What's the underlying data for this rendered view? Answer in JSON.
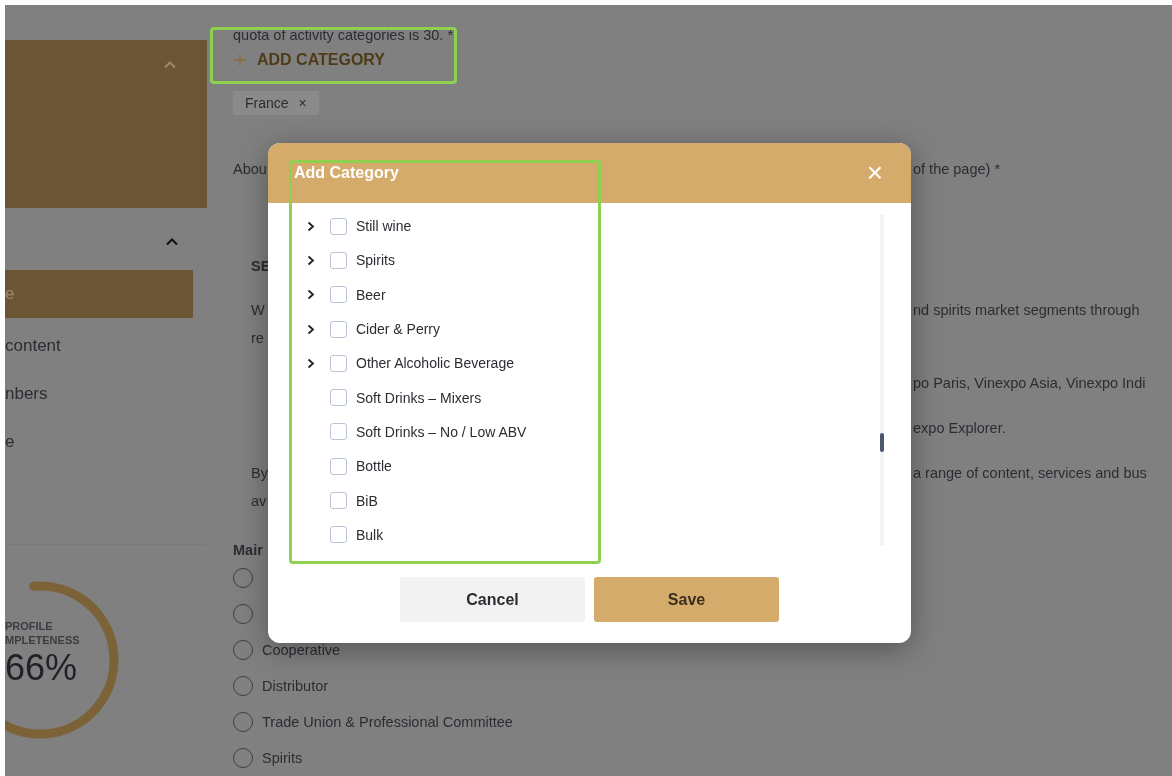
{
  "sidebar": {
    "groups": [
      {
        "expanded": true
      },
      {
        "expanded": true,
        "items": [
          {
            "label": "e",
            "selected": true
          },
          {
            "label": "content",
            "selected": false
          },
          {
            "label": "nbers",
            "selected": false
          },
          {
            "label": "e",
            "selected": false
          }
        ]
      }
    ],
    "profile": {
      "title_lines": [
        "PROFILE",
        "MPLETENESS"
      ],
      "value": "66%",
      "level": 0.66
    }
  },
  "main": {
    "intro": "quota of activity categories is 30. *",
    "add_button": "ADD CATEGORY",
    "chips": [
      {
        "label": "France",
        "close": "×"
      }
    ],
    "about": {
      "left": "Abou",
      "right": "of the page) *"
    },
    "section": {
      "heading": "SE",
      "paragraphs": [
        [
          {
            "left": "W",
            "right": "nd spirits market segments through"
          },
          {
            "left": "re"
          }
        ],
        [
          {
            "right": "po Paris, Vinexpo Asia, Vinexpo Indi"
          }
        ],
        [
          {
            "right": "expo Explorer."
          }
        ],
        [
          {
            "left": "By",
            "right": "a range of content, services and bus"
          },
          {
            "left": "av"
          }
        ]
      ]
    },
    "main_activity": {
      "label": "Mair",
      "options": [
        {
          "selected": false
        },
        {
          "selected": false
        },
        {
          "label": "Cooperative",
          "selected": false
        },
        {
          "label": "Distributor",
          "selected": false
        },
        {
          "label": "Trade Union & Professional Committee",
          "selected": false
        },
        {
          "label": "Spirits",
          "selected": false
        }
      ]
    }
  },
  "dialog": {
    "title": "Add Category",
    "close": "×",
    "items": [
      {
        "label": "Still wine",
        "expandable": true,
        "checked": false
      },
      {
        "label": "Spirits",
        "expandable": true,
        "checked": false
      },
      {
        "label": "Beer",
        "expandable": true,
        "checked": false
      },
      {
        "label": "Cider & Perry",
        "expandable": true,
        "checked": false
      },
      {
        "label": "Other Alcoholic Beverage",
        "expandable": true,
        "checked": false
      },
      {
        "label": "Soft Drinks – Mixers",
        "expandable": false,
        "checked": false
      },
      {
        "label": "Soft Drinks – No / Low ABV",
        "expandable": false,
        "checked": false
      },
      {
        "label": "Bottle",
        "expandable": false,
        "checked": false
      },
      {
        "label": "BiB",
        "expandable": false,
        "checked": false
      },
      {
        "label": "Bulk",
        "expandable": false,
        "checked": false
      }
    ],
    "buttons": [
      {
        "label": "Cancel",
        "kind": "secondary"
      },
      {
        "label": "Save",
        "kind": "primary"
      }
    ]
  }
}
